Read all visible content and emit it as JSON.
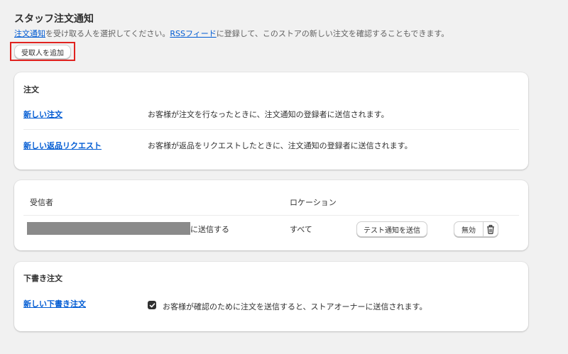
{
  "header": {
    "title": "スタッフ注文通知",
    "desc_link1": "注文通知",
    "desc_text1": "を受け取る人を選択してください。",
    "desc_link2": "RSSフィード",
    "desc_text2": "に登録して、このストアの新しい注文を確認することもできます。",
    "add_recipient_label": "受取人を追加"
  },
  "orders_card": {
    "heading": "注文",
    "rows": [
      {
        "label": "新しい注文",
        "description": "お客様が注文を行なったときに、注文通知の登録者に送信されます。"
      },
      {
        "label": "新しい返品リクエスト",
        "description": "お客様が返品をリクエストしたときに、注文通知の登録者に送信されます。"
      }
    ]
  },
  "recipients_card": {
    "col_recipient": "受信者",
    "col_location": "ロケーション",
    "row": {
      "recipient_suffix": "に送信する",
      "location": "すべて",
      "test_button": "テスト通知を送信",
      "disable_button": "無効"
    }
  },
  "drafts_card": {
    "heading": "下書き注文",
    "link": "新しい下書き注文",
    "checkbox_label": "お客様が確認のために注文を送信すると、ストアオーナーに送信されます。",
    "checked": true
  },
  "colors": {
    "link": "#005bd3",
    "highlight_outline": "#e0221f",
    "background": "#f1f1f1"
  }
}
